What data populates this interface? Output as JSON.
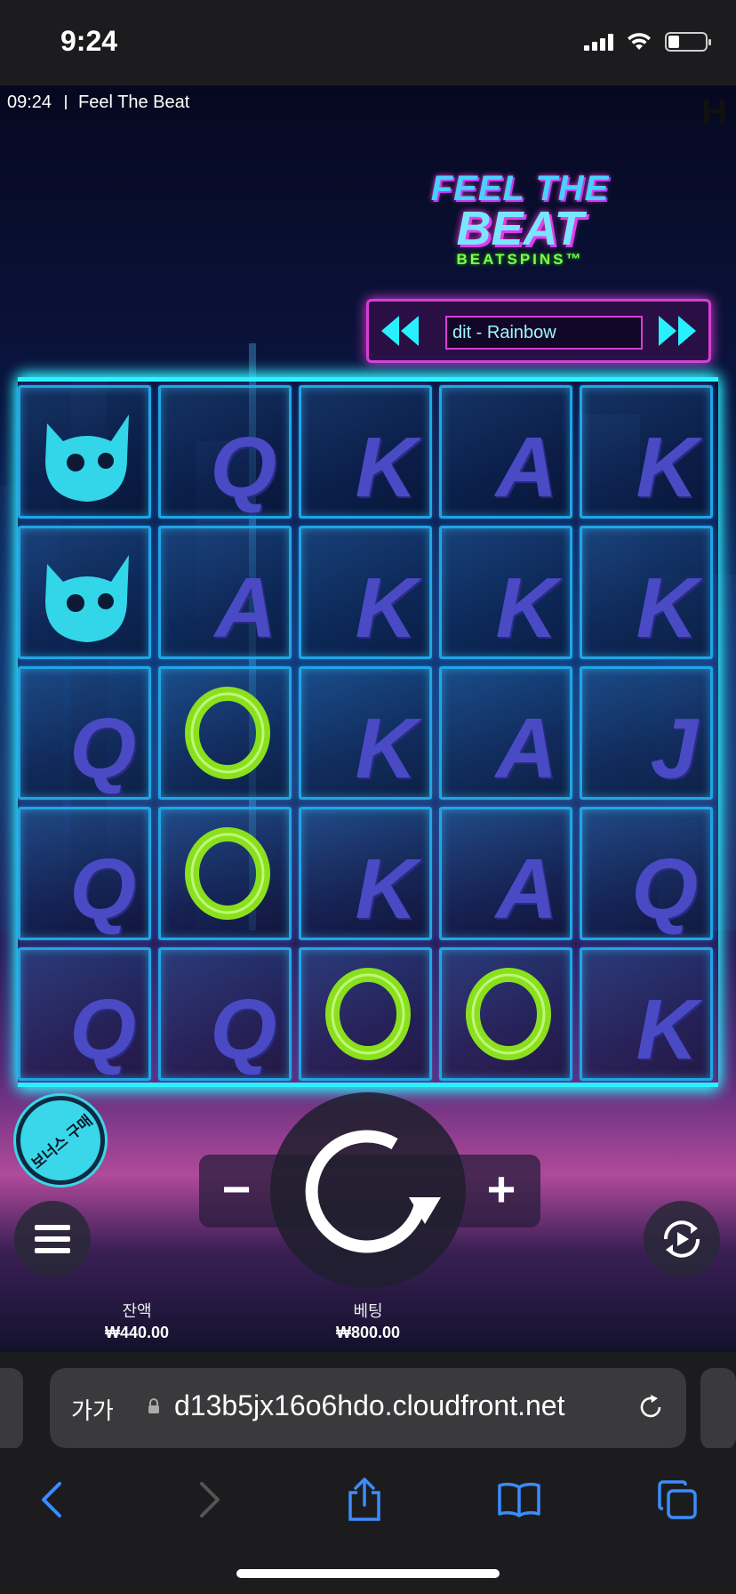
{
  "status_bar": {
    "time": "9:24"
  },
  "game": {
    "clock": "09:24",
    "title": "Feel The Beat",
    "provider_mark": "H",
    "logo": {
      "line1": "FEEL THE",
      "line2": "BEAT",
      "line3": "BEATSPINS™"
    },
    "mode_selector": {
      "label": "dit - Rainbow"
    },
    "reels": [
      [
        "cat",
        "Q",
        "K",
        "A",
        "K"
      ],
      [
        "cat",
        "A",
        "K",
        "K",
        "K"
      ],
      [
        "Q",
        "ring",
        "K",
        "A",
        "J"
      ],
      [
        "Q",
        "ring",
        "K",
        "A",
        "Q"
      ],
      [
        "Q",
        "Q",
        "ring",
        "ring",
        "K"
      ]
    ],
    "bonus_buy_label": "보너스 구매",
    "balance": {
      "label": "잔액",
      "value": "₩440.00"
    },
    "bet": {
      "label": "베팅",
      "value": "₩800.00"
    },
    "minus_label": "−",
    "plus_label": "+"
  },
  "browser": {
    "text_size_label": "가가",
    "url": "d13b5jx16o6hdo.cloudfront.net"
  },
  "colors": {
    "neon_cyan": "#2ef2ff",
    "neon_pink": "#d93cd6",
    "symbol_purple": "#4a4bc4",
    "ring_green": "#8be01e"
  }
}
